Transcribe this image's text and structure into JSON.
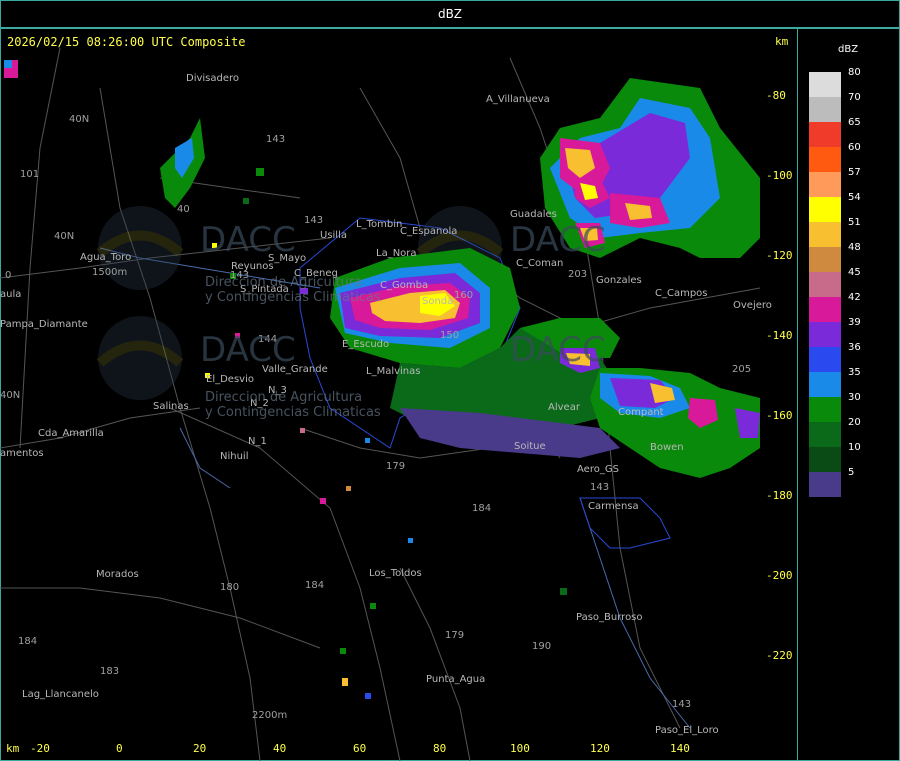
{
  "header": {
    "title": "dBZ"
  },
  "map": {
    "timestamp": "2026/02/15 08:26:00 UTC Composite",
    "km_top": "km",
    "km_bottom": "km",
    "y_ticks": [
      "-80",
      "-100",
      "-120",
      "-140",
      "-160",
      "-180",
      "-200",
      "-220"
    ],
    "x_ticks": [
      "-20",
      "0",
      "20",
      "40",
      "60",
      "80",
      "100",
      "120",
      "140"
    ],
    "places": [
      "Divisadero",
      "A_Villanueva",
      "Guadales",
      "Usilla",
      "L_Tombin",
      "C_Espanola",
      "La_Nora",
      "Agua_Toro",
      "Reyunos",
      "S_Mayo",
      "C_Beneg",
      "C_Gomba",
      "S_Pintada",
      "Sonda",
      "C_Coman",
      "Gonzales",
      "C_Campos",
      "Ovejero",
      "aula",
      "Pampa_Diamante",
      "E_Escudo",
      "L_Malvinas",
      "Valle_Grande",
      "El_Desvio",
      "Salinas",
      "Cda_Amarilla",
      "amentos",
      "N_2",
      "N_3",
      "N_1",
      "Nihuil",
      "Soitue",
      "Aero_GS",
      "Bowen",
      "Carmensa",
      "Los_Toldos",
      "Morados",
      "Paso_Burroso",
      "Punta_Agua",
      "Lag_Llancanelo",
      "Paso_El_Loro",
      "Alvear",
      "Compant"
    ],
    "routes": [
      "143",
      "143",
      "101",
      "40N",
      "40N",
      "40",
      "143",
      "144",
      "150",
      "179",
      "184",
      "180",
      "184",
      "183",
      "184",
      "179",
      "190",
      "143",
      "203",
      "160",
      "143",
      "205",
      "1500m",
      "2200m",
      "40N",
      "0"
    ],
    "watermark": {
      "logo": "DACC",
      "line1": "Direccion de Agricultura",
      "line2": "y Contingencias Climaticas"
    }
  },
  "legend": {
    "unit": "dBZ",
    "levels": [
      {
        "label": "80",
        "color": "#dcdcdc"
      },
      {
        "label": "70",
        "color": "#bcbcbc"
      },
      {
        "label": "65",
        "color": "#f03a2a"
      },
      {
        "label": "60",
        "color": "#ff5a10"
      },
      {
        "label": "57",
        "color": "#ff9a5a"
      },
      {
        "label": "54",
        "color": "#ffff00"
      },
      {
        "label": "51",
        "color": "#f8c030"
      },
      {
        "label": "48",
        "color": "#d08a40"
      },
      {
        "label": "45",
        "color": "#c86a8a"
      },
      {
        "label": "42",
        "color": "#d81a9a"
      },
      {
        "label": "39",
        "color": "#7a2ad8"
      },
      {
        "label": "36",
        "color": "#2a4af0"
      },
      {
        "label": "35",
        "color": "#1a8ae8"
      },
      {
        "label": "30",
        "color": "#0a8a0a"
      },
      {
        "label": "20",
        "color": "#0a6a1a"
      },
      {
        "label": "10",
        "color": "#0a4a14"
      },
      {
        "label": "5",
        "color": "#4a3a8a"
      }
    ]
  }
}
